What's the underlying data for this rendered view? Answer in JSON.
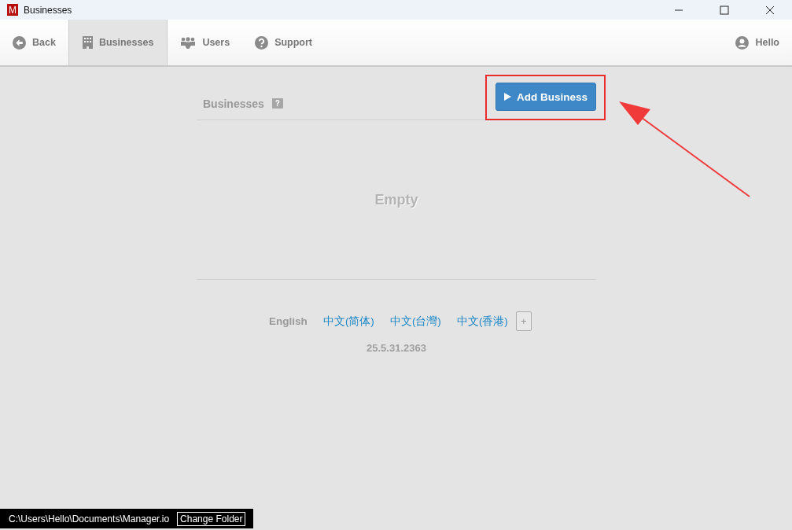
{
  "window": {
    "app_letter": "M",
    "title": "Businesses"
  },
  "nav": [
    {
      "label": "Back",
      "kind": "back",
      "selected": false
    },
    {
      "label": "Businesses",
      "kind": "building",
      "selected": true
    },
    {
      "label": "Users",
      "kind": "users",
      "selected": false
    },
    {
      "label": "Support",
      "kind": "help",
      "selected": false
    }
  ],
  "user": {
    "label": "Hello"
  },
  "section": {
    "title": "Businesses",
    "help": "?",
    "add_button": "Add Business",
    "empty": "Empty"
  },
  "languages": [
    {
      "label": "English",
      "selected": true
    },
    {
      "label": "中文(简体)",
      "selected": false
    },
    {
      "label": "中文(台灣)",
      "selected": false
    },
    {
      "label": "中文(香港)",
      "selected": false
    }
  ],
  "add_language": "+",
  "version": "25.5.31.2363",
  "footer": {
    "path": "C:\\Users\\Hello\\Documents\\Manager.io",
    "button": "Change Folder"
  }
}
